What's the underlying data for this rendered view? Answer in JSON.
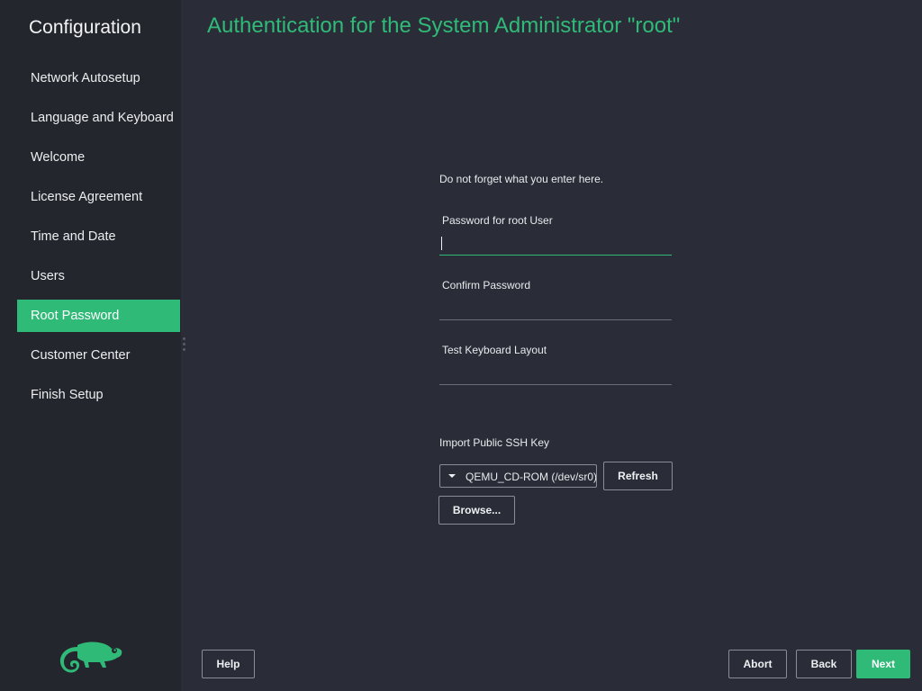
{
  "sidebar": {
    "title": "Configuration",
    "items": [
      {
        "label": "Network Autosetup",
        "active": false
      },
      {
        "label": "Language and Keyboard",
        "active": false
      },
      {
        "label": "Welcome",
        "active": false
      },
      {
        "label": "License Agreement",
        "active": false
      },
      {
        "label": "Time and Date",
        "active": false
      },
      {
        "label": "Users",
        "active": false
      },
      {
        "label": "Root Password",
        "active": true
      },
      {
        "label": "Customer Center",
        "active": false
      },
      {
        "label": "Finish Setup",
        "active": false
      }
    ],
    "logo_icon": "chameleon-logo-icon"
  },
  "page": {
    "title": "Authentication for the System Administrator \"root\""
  },
  "form": {
    "hint": "Do not forget what you enter here.",
    "password_label": "Password for root User",
    "password_value": "",
    "confirm_label": "Confirm Password",
    "confirm_value": "",
    "keyboard_label": "Test Keyboard Layout",
    "keyboard_value": ""
  },
  "ssh": {
    "label": "Import Public SSH Key",
    "device_selected": "QEMU_CD-ROM (/dev/sr0)",
    "refresh_label": "Refresh",
    "browse_label": "Browse..."
  },
  "footer": {
    "help_label": "Help",
    "abort_label": "Abort",
    "back_label": "Back",
    "next_label": "Next"
  },
  "colors": {
    "accent": "#30ba78",
    "sidebar_bg": "#24262e",
    "content_bg": "#2a2d38"
  }
}
